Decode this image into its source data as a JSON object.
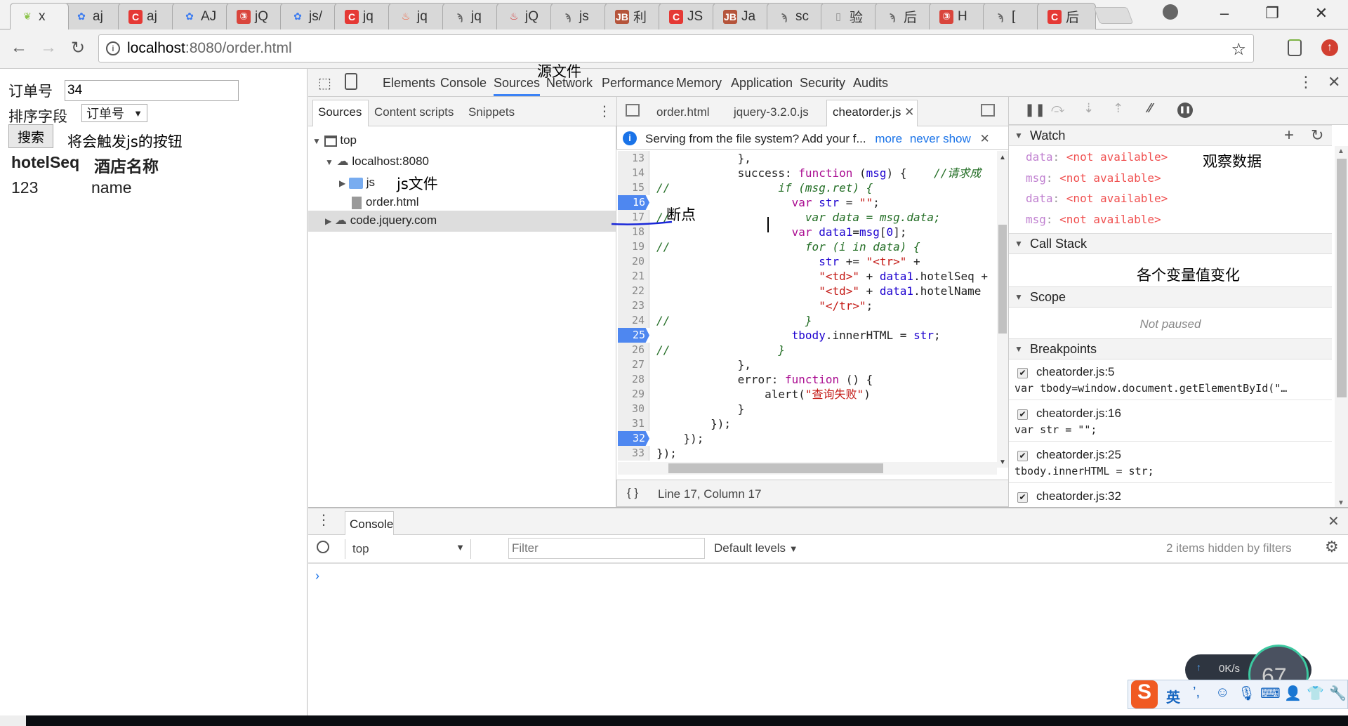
{
  "browser": {
    "tabs": [
      {
        "label": "x",
        "icon": "leaf",
        "color": "#8bc34a",
        "active": true
      },
      {
        "label": "aj",
        "icon": "paw",
        "color": "#3b7bf0"
      },
      {
        "label": "aj",
        "icon": "c",
        "color": "#e53935"
      },
      {
        "label": "AJ",
        "icon": "paw",
        "color": "#3b7bf0"
      },
      {
        "label": "jQ",
        "icon": "shield",
        "color": "#d9453c"
      },
      {
        "label": "js/",
        "icon": "paw",
        "color": "#3b7bf0"
      },
      {
        "label": "jq",
        "icon": "c",
        "color": "#e53935"
      },
      {
        "label": "jq",
        "icon": "flame",
        "color": "#f0603c"
      },
      {
        "label": "jq",
        "icon": "swirl",
        "color": "#666666"
      },
      {
        "label": "jQ",
        "icon": "flame",
        "color": "#d32f2f"
      },
      {
        "label": "js",
        "icon": "swirl",
        "color": "#666666"
      },
      {
        "label": "利",
        "icon": "jb",
        "color": "#b5543b"
      },
      {
        "label": "JS",
        "icon": "c",
        "color": "#e53935"
      },
      {
        "label": "Ja",
        "icon": "jb",
        "color": "#b5543b"
      },
      {
        "label": "sc",
        "icon": "swirl",
        "color": "#666666"
      },
      {
        "label": "验",
        "icon": "doc",
        "color": "#888888"
      },
      {
        "label": "后",
        "icon": "swirl",
        "color": "#666666"
      },
      {
        "label": "H",
        "icon": "shield",
        "color": "#d9453c"
      },
      {
        "label": "[",
        "icon": "swirl",
        "color": "#666666"
      },
      {
        "label": "后",
        "icon": "c",
        "color": "#e53935"
      }
    ],
    "url_host": "localhost",
    "url_rest": ":8080/order.html"
  },
  "page": {
    "order_label": "订单号",
    "order_value": "34",
    "sort_label": "排序字段",
    "sort_value": "订单号",
    "search_button": "搜索",
    "search_note": "将会触发js的按钮",
    "table_headers": [
      "hotelSeq",
      "酒店名称"
    ],
    "table_row": [
      "123",
      "name"
    ]
  },
  "devtools": {
    "tabs": [
      "Elements",
      "Console",
      "Sources",
      "Network",
      "Performance",
      "Memory",
      "Application",
      "Security",
      "Audits"
    ],
    "active_tab": "Sources",
    "sources_annotation": "源文件",
    "nav_tabs": [
      "Sources",
      "Content scripts",
      "Snippets"
    ],
    "tree": {
      "top": "top",
      "host": "localhost:8080",
      "js": "js",
      "js_note": "js文件",
      "file": "order.html",
      "cdn": "code.jquery.com"
    },
    "editor_tabs": [
      "order.html",
      "jquery-3.2.0.js",
      "cheatorder.js"
    ],
    "infobar": {
      "text": "Serving from the file system? Add your f...",
      "more": "more",
      "never": "never show"
    },
    "breakpoint_note": "断点",
    "code": [
      {
        "n": "13",
        "bp": false,
        "t": [
          [
            "p",
            "            },"
          ]
        ]
      },
      {
        "n": "14",
        "bp": false,
        "t": [
          [
            "p",
            "            success: "
          ],
          [
            "k",
            "function"
          ],
          [
            "p",
            " ("
          ],
          [
            "v",
            "msg"
          ],
          [
            "p",
            ") {    "
          ],
          [
            "kc",
            "//请求成"
          ]
        ]
      },
      {
        "n": "15",
        "bp": false,
        "t": [
          [
            "c",
            "//"
          ],
          [
            "p",
            "                "
          ],
          [
            "c",
            "if (msg.ret) {"
          ]
        ]
      },
      {
        "n": "16",
        "bp": true,
        "t": [
          [
            "p",
            "                    "
          ],
          [
            "k",
            "var "
          ],
          [
            "v",
            "str"
          ],
          [
            "p",
            " = "
          ],
          [
            "s",
            "\"\""
          ],
          [
            "p",
            ";"
          ]
        ]
      },
      {
        "n": "17",
        "bp": false,
        "t": [
          [
            "c",
            "//"
          ],
          [
            "p",
            "                    "
          ],
          [
            "c",
            "var data = msg.data;"
          ]
        ]
      },
      {
        "n": "18",
        "bp": false,
        "t": [
          [
            "p",
            "                    "
          ],
          [
            "k",
            "var "
          ],
          [
            "v",
            "data1"
          ],
          [
            "p",
            "="
          ],
          [
            "v",
            "msg"
          ],
          [
            "p",
            "["
          ],
          [
            "n",
            "0"
          ],
          [
            "p",
            "];"
          ]
        ]
      },
      {
        "n": "19",
        "bp": false,
        "t": [
          [
            "c",
            "//"
          ],
          [
            "p",
            "                    "
          ],
          [
            "c",
            "for (i in data) {"
          ]
        ]
      },
      {
        "n": "20",
        "bp": false,
        "t": [
          [
            "p",
            "                        "
          ],
          [
            "v",
            "str"
          ],
          [
            "p",
            " += "
          ],
          [
            "s",
            "\"<tr>\""
          ],
          [
            "p",
            " +"
          ]
        ]
      },
      {
        "n": "21",
        "bp": false,
        "t": [
          [
            "p",
            "                        "
          ],
          [
            "s",
            "\"<td>\""
          ],
          [
            "p",
            " + "
          ],
          [
            "v",
            "data1"
          ],
          [
            "p",
            ".hotelSeq +"
          ]
        ]
      },
      {
        "n": "22",
        "bp": false,
        "t": [
          [
            "p",
            "                        "
          ],
          [
            "s",
            "\"<td>\""
          ],
          [
            "p",
            " + "
          ],
          [
            "v",
            "data1"
          ],
          [
            "p",
            ".hotelName"
          ]
        ]
      },
      {
        "n": "23",
        "bp": false,
        "t": [
          [
            "p",
            "                        "
          ],
          [
            "s",
            "\"</tr>\""
          ],
          [
            "p",
            ";"
          ]
        ]
      },
      {
        "n": "24",
        "bp": false,
        "t": [
          [
            "c",
            "//"
          ],
          [
            "p",
            "                    "
          ],
          [
            "c",
            "}"
          ]
        ]
      },
      {
        "n": "25",
        "bp": true,
        "t": [
          [
            "p",
            "                    "
          ],
          [
            "v",
            "tbody"
          ],
          [
            "p",
            ".innerHTML = "
          ],
          [
            "v",
            "str"
          ],
          [
            "p",
            ";"
          ]
        ]
      },
      {
        "n": "26",
        "bp": false,
        "t": [
          [
            "c",
            "//"
          ],
          [
            "p",
            "                "
          ],
          [
            "c",
            "}"
          ]
        ]
      },
      {
        "n": "27",
        "bp": false,
        "t": [
          [
            "p",
            "            },"
          ]
        ]
      },
      {
        "n": "28",
        "bp": false,
        "t": [
          [
            "p",
            "            error: "
          ],
          [
            "k",
            "function"
          ],
          [
            "p",
            " () {"
          ]
        ]
      },
      {
        "n": "29",
        "bp": false,
        "t": [
          [
            "p",
            "                alert("
          ],
          [
            "s",
            "\"查询失败\""
          ],
          [
            "p",
            ")"
          ]
        ]
      },
      {
        "n": "30",
        "bp": false,
        "t": [
          [
            "p",
            "            }"
          ]
        ]
      },
      {
        "n": "31",
        "bp": false,
        "t": [
          [
            "p",
            "        });"
          ]
        ]
      },
      {
        "n": "32",
        "bp": true,
        "t": [
          [
            "p",
            "    });"
          ]
        ]
      },
      {
        "n": "33",
        "bp": false,
        "t": [
          [
            "p",
            "});"
          ]
        ]
      }
    ],
    "status": "Line 17, Column 17",
    "watch": {
      "title": "Watch",
      "note": "观察数据",
      "items": [
        [
          "data",
          "<not available>"
        ],
        [
          "msg",
          "<not available>"
        ],
        [
          "data",
          "<not available>"
        ],
        [
          "msg",
          "<not available>"
        ]
      ]
    },
    "callstack": {
      "title": "Call Stack",
      "note": "各个变量值变化"
    },
    "scope": {
      "title": "Scope",
      "empty": "Not paused"
    },
    "breakpoints": {
      "title": "Breakpoints",
      "items": [
        {
          "file": "cheatorder.js:5",
          "code": "var tbody=window.document.getElementById(\"…"
        },
        {
          "file": "cheatorder.js:16",
          "code": "var str = \"\";"
        },
        {
          "file": "cheatorder.js:25",
          "code": "tbody.innerHTML = str;"
        },
        {
          "file": "cheatorder.js:32",
          "code": ""
        }
      ]
    },
    "console": {
      "tab": "Console",
      "context": "top",
      "filter_placeholder": "Filter",
      "levels": "Default levels",
      "hidden": "2 items hidden by filters"
    }
  },
  "widget": {
    "speed": "0K/s",
    "percent": "67",
    "ime_lang": "英"
  }
}
